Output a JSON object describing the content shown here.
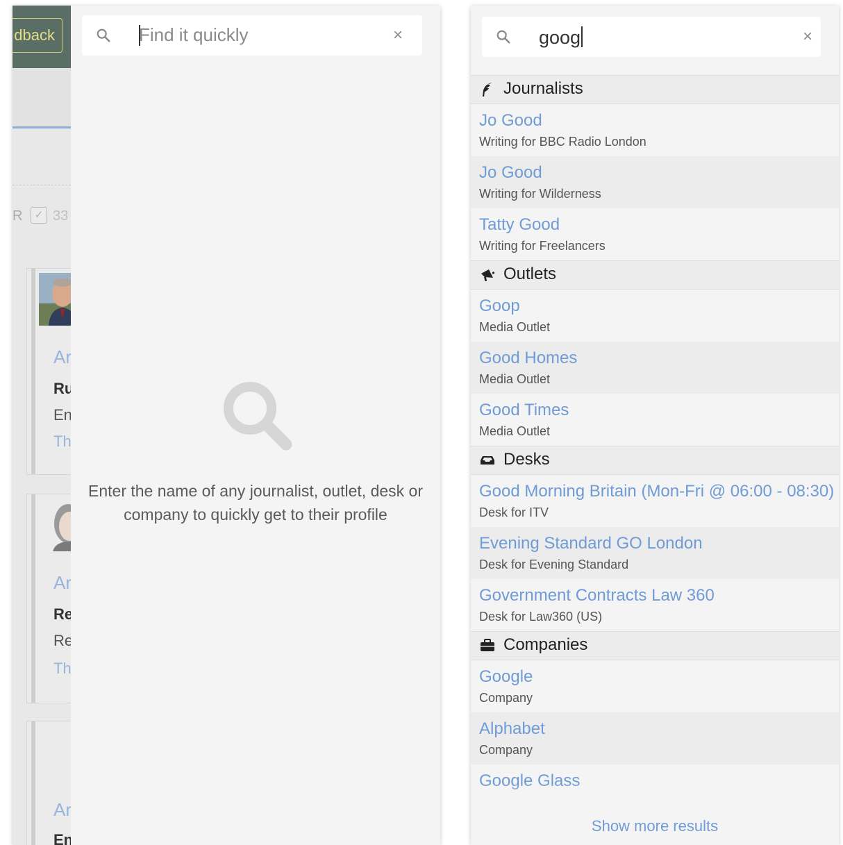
{
  "background_app": {
    "feedback_button": "dback",
    "filter_letter": "R",
    "filter_checkbox_mark": "✓",
    "filter_count": "33",
    "cards": [
      {
        "line1": "Ar",
        "line2": "Ru",
        "line3": "En",
        "line4": "Th"
      },
      {
        "line1": "Ar",
        "line2": "Re",
        "line3": "Re",
        "line4": "Th"
      },
      {
        "line1": "Ar",
        "line2": "En"
      }
    ]
  },
  "empty_search": {
    "placeholder": "Find it quickly",
    "clear_icon": "×",
    "empty_message": "Enter the name of any journalist, outlet, desk or company to quickly get to their profile"
  },
  "results_search": {
    "query": "goog",
    "clear_icon": "×",
    "groups": [
      {
        "label": "Journalists",
        "icon": "quill-icon",
        "items": [
          {
            "title": "Jo Good",
            "subtitle": "Writing for BBC Radio London"
          },
          {
            "title": "Jo Good",
            "subtitle": "Writing for Wilderness"
          },
          {
            "title": "Tatty Good",
            "subtitle": "Writing for Freelancers"
          }
        ]
      },
      {
        "label": "Outlets",
        "icon": "megaphone-icon",
        "items": [
          {
            "title": "Goop",
            "subtitle": "Media Outlet"
          },
          {
            "title": "Good Homes",
            "subtitle": "Media Outlet"
          },
          {
            "title": "Good Times",
            "subtitle": "Media Outlet"
          }
        ]
      },
      {
        "label": "Desks",
        "icon": "inbox-icon",
        "items": [
          {
            "title": "Good Morning Britain (Mon-Fri @ 06:00 - 08:30)",
            "subtitle": "Desk for ITV"
          },
          {
            "title": "Evening Standard GO London",
            "subtitle": "Desk for Evening Standard"
          },
          {
            "title": "Government Contracts Law 360",
            "subtitle": "Desk for Law360 (US)"
          }
        ]
      },
      {
        "label": "Companies",
        "icon": "briefcase-icon",
        "items": [
          {
            "title": "Google",
            "subtitle": "Company"
          },
          {
            "title": "Alphabet",
            "subtitle": "Company"
          },
          {
            "title": "Google Glass",
            "subtitle": ""
          }
        ]
      }
    ],
    "show_more": "Show more results"
  },
  "colors": {
    "link_blue": "#6f9bd6",
    "panel_bg": "#f4f4f4",
    "group_header_bg": "#ececec",
    "top_bar_green": "#5b6e65",
    "feedback_yellow": "#d4cf77"
  }
}
